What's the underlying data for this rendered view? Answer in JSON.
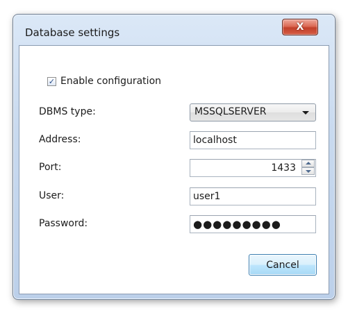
{
  "window": {
    "title": "Database settings",
    "close_glyph": "X"
  },
  "form": {
    "enable": {
      "label": "Enable configuration",
      "checked": true
    },
    "dbms": {
      "label": "DBMS type:",
      "value": "MSSQLSERVER"
    },
    "address": {
      "label": "Address:",
      "value": "localhost"
    },
    "port": {
      "label": "Port:",
      "value": "1433"
    },
    "user": {
      "label": "User:",
      "value": "user1"
    },
    "password": {
      "label": "Password:",
      "value": "●●●●●●●●●"
    }
  },
  "buttons": {
    "cancel": "Cancel"
  },
  "colors": {
    "close_button": "#c9452f",
    "accent": "#3c7fb1"
  },
  "icons": {
    "close": "close-icon",
    "check": "checkmark-icon",
    "dropdown": "chevron-down-icon",
    "spin_up": "arrow-up-icon",
    "spin_down": "arrow-down-icon"
  }
}
